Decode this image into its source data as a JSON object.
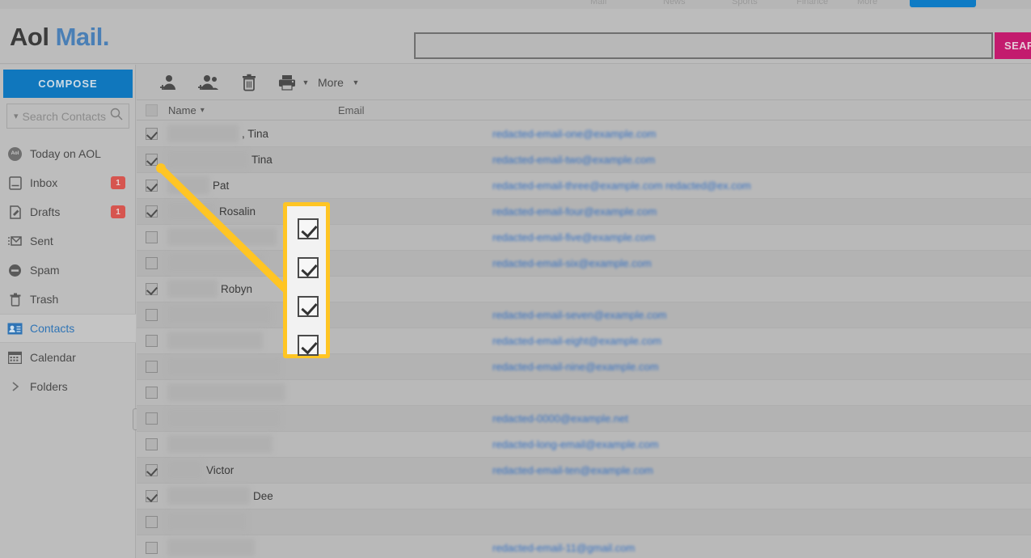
{
  "brand": {
    "logo_aol": "Aol",
    "logo_mail": "Mail",
    "logo_dot": "."
  },
  "topbar": {
    "items": [
      "Mail",
      "News",
      "Sports",
      "Finance",
      "More"
    ]
  },
  "search": {
    "value": "",
    "placeholder": "",
    "button_label": "SEARCH"
  },
  "sidebar": {
    "compose_label": "COMPOSE",
    "contact_search": {
      "label": "Search Contacts",
      "chevron_icon": "chevron-down-icon",
      "search_icon": "magnifier-icon"
    },
    "items": [
      {
        "label": "Today on AOL",
        "icon": "aol-circle-icon",
        "badge": "",
        "active": false
      },
      {
        "label": "Inbox",
        "icon": "inbox-icon",
        "badge": "1",
        "active": false
      },
      {
        "label": "Drafts",
        "icon": "drafts-icon",
        "badge": "1",
        "active": false
      },
      {
        "label": "Sent",
        "icon": "sent-icon",
        "badge": "",
        "active": false
      },
      {
        "label": "Spam",
        "icon": "spam-icon",
        "badge": "",
        "active": false
      },
      {
        "label": "Trash",
        "icon": "trash-icon",
        "badge": "",
        "active": false
      },
      {
        "label": "Contacts",
        "icon": "contacts-icon",
        "badge": "",
        "active": true
      },
      {
        "label": "Calendar",
        "icon": "calendar-icon",
        "badge": "",
        "active": false
      },
      {
        "label": "Folders",
        "icon": "chevron-right-icon",
        "badge": "",
        "active": false
      }
    ]
  },
  "toolbar": {
    "add_contact_icon": "add-contact-icon",
    "add_group_icon": "add-group-icon",
    "delete_icon": "trash-icon",
    "print_icon": "printer-icon",
    "print_caret_icon": "caret-down-icon",
    "more_label": "More",
    "more_caret_icon": "caret-down-icon"
  },
  "contacts_table": {
    "columns": [
      "Name",
      "Email"
    ],
    "sort_icon": "chevron-down-icon",
    "header_select_all_checked": false,
    "rows": [
      {
        "checked": true,
        "blur_w": 88,
        "name": ", Tina",
        "email": "redacted-email-one@example.com",
        "alt": false
      },
      {
        "checked": true,
        "blur_w": 100,
        "name": "Tina",
        "email": "redacted-email-two@example.com",
        "alt": true
      },
      {
        "checked": true,
        "blur_w": 52,
        "name": "Pat",
        "email": "redacted-email-three@example.com  redacted@ex.com",
        "alt": false
      },
      {
        "checked": true,
        "blur_w": 60,
        "name": "Rosalin",
        "email": "redacted-email-four@example.com",
        "alt": true
      },
      {
        "checked": false,
        "blur_w": 135,
        "name": "",
        "email": "redacted-email-five@example.com",
        "alt": false
      },
      {
        "checked": false,
        "blur_w": 120,
        "name": "",
        "email": "redacted-email-six@example.com",
        "alt": true
      },
      {
        "checked": true,
        "blur_w": 62,
        "name": "Robyn",
        "email": "",
        "alt": false
      },
      {
        "checked": false,
        "blur_w": 128,
        "name": "",
        "email": "redacted-email-seven@example.com",
        "alt": true
      },
      {
        "checked": false,
        "blur_w": 118,
        "name": "",
        "email": "redacted-email-eight@example.com",
        "alt": false
      },
      {
        "checked": false,
        "blur_w": 140,
        "name": "",
        "email": "redacted-email-nine@example.com",
        "alt": true
      },
      {
        "checked": false,
        "blur_w": 146,
        "name": "",
        "email": "",
        "alt": false
      },
      {
        "checked": false,
        "blur_w": 140,
        "name": "",
        "email": "redacted-0000@example.net",
        "alt": true
      },
      {
        "checked": false,
        "blur_w": 130,
        "name": "",
        "email": "redacted-long-email@example.com",
        "alt": false
      },
      {
        "checked": true,
        "blur_w": 44,
        "name": "Victor",
        "email": "redacted-email-ten@example.com",
        "alt": true
      },
      {
        "checked": true,
        "blur_w": 102,
        "name": "Dee",
        "email": "",
        "alt": false
      },
      {
        "checked": false,
        "blur_w": 98,
        "name": "",
        "email": "",
        "alt": true
      },
      {
        "checked": false,
        "blur_w": 108,
        "name": "",
        "email": "redacted-email-11@gmail.com",
        "alt": false
      }
    ]
  },
  "annotation": {
    "callout_checkbox_count": 4,
    "highlight_color": "#ffc524",
    "pointer_from": "row-checkbox-column",
    "pointer_to": "callout-box"
  },
  "colors": {
    "accent_blue": "#1077bd",
    "search_button": "#c31b6e",
    "badge_red": "#d6554f",
    "highlight_yellow": "#ffc524",
    "email_link": "#2a6bc4"
  }
}
